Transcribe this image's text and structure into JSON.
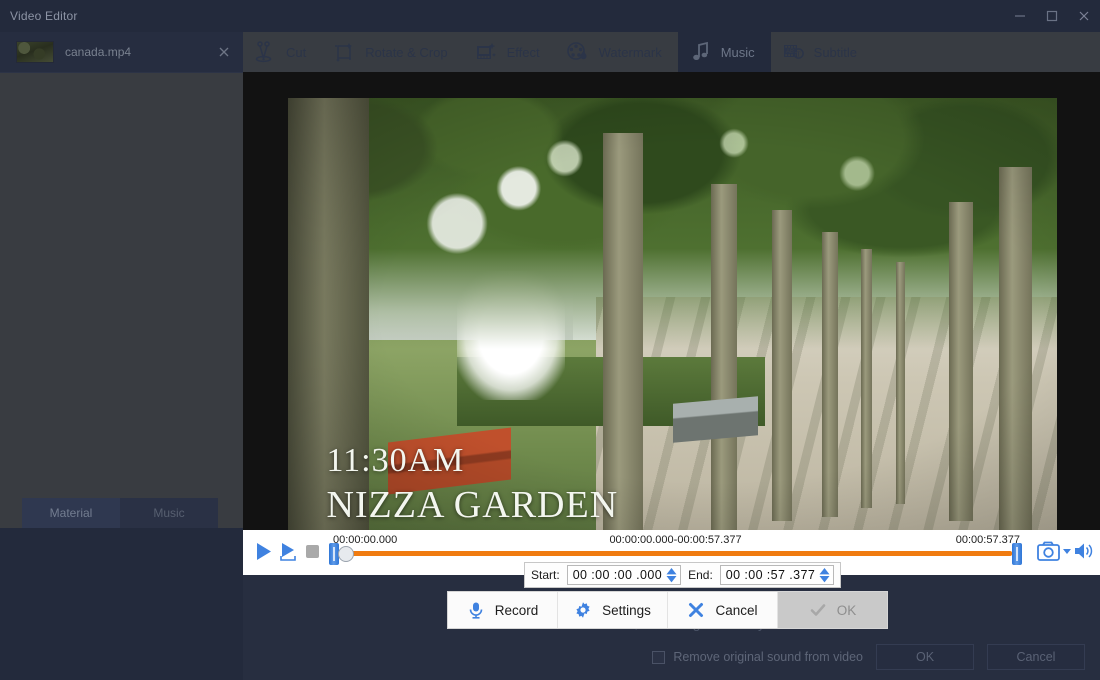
{
  "window": {
    "title": "Video Editor",
    "minimize_icon": "minimize-icon",
    "maximize_icon": "maximize-icon",
    "close_icon": "close-icon"
  },
  "sidebar": {
    "file": {
      "name": "canada.mp4",
      "close_icon": "close-icon",
      "thumbnail": "video-thumbnail"
    },
    "tabs": [
      {
        "label": "Material",
        "active": true
      },
      {
        "label": "Music",
        "active": false
      }
    ]
  },
  "toolbar": {
    "items": [
      {
        "label": "Cut",
        "icon": "scissors-icon",
        "active": false
      },
      {
        "label": "Rotate & Crop",
        "icon": "crop-icon",
        "active": false
      },
      {
        "label": "Effect",
        "icon": "film-sparkle-icon",
        "active": false
      },
      {
        "label": "Watermark",
        "icon": "film-reel-droplet-icon",
        "active": false
      },
      {
        "label": "Music",
        "icon": "music-note-icon",
        "active": true
      },
      {
        "label": "Subtitle",
        "icon": "film-text-icon",
        "active": false
      }
    ]
  },
  "video": {
    "overlay_line1": "11:30AM",
    "overlay_line2": "NIZZA GARDEN",
    "scene_description": "tree-lined park path"
  },
  "player": {
    "play_icon": "play-icon",
    "play_selection_icon": "play-selection-icon",
    "stop_icon": "stop-icon",
    "snapshot_icon": "camera-icon",
    "snapshot_dropdown_icon": "chevron-down-icon",
    "volume_icon": "volume-icon",
    "time_start": "00:00:00.000",
    "time_range": "00:00:00.000-00:00:57.377",
    "time_end": "00:00:57.377",
    "progress_color": "#f07b10",
    "handle_color": "#2f76d6"
  },
  "trim": {
    "start_label": "Start:",
    "start_value": "00 :00 :00 .000",
    "end_label": "End:",
    "end_value": "00 :00 :57 .377",
    "stepper_icon": "spinner-arrows-icon"
  },
  "actions": {
    "record": {
      "label": "Record",
      "icon": "microphone-icon",
      "disabled": false
    },
    "settings": {
      "label": "Settings",
      "icon": "gear-icon",
      "disabled": false
    },
    "cancel": {
      "label": "Cancel",
      "icon": "x-icon",
      "disabled": false
    },
    "ok": {
      "label": "OK",
      "icon": "check-icon",
      "disabled": true
    }
  },
  "footer": {
    "hint": "You can add music, recording audio to your video.",
    "checkbox_label": "Remove original sound from video",
    "checkbox_checked": false,
    "ok_label": "OK",
    "cancel_label": "Cancel"
  },
  "colors": {
    "accent_blue": "#3f82e0",
    "accent_orange": "#f07b10",
    "window_bg": "#232a3c",
    "panel_bg": "#393c41"
  }
}
